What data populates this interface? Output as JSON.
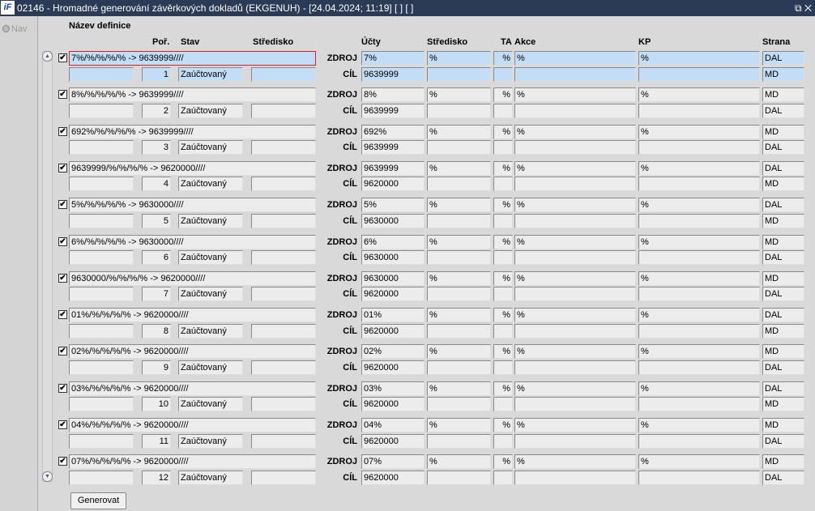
{
  "window": {
    "title": "02146 - Hromadné generování závěrkových dokladů (EKGENUH) - [24.04.2024; 11:19]  [ ]  [ ]",
    "logo": "iF",
    "controls": "⧉ ✕"
  },
  "nav": {
    "label": "Nav"
  },
  "headers": {
    "nazev": "Název definice",
    "por": "Poř.",
    "stav": "Stav",
    "stredisko": "Středisko",
    "ucty": "Účty",
    "stredisko2": "Středisko",
    "ta": "TA",
    "akce": "Akce",
    "kp": "KP",
    "strana": "Strana"
  },
  "labels": {
    "zdroj": "ZDROJ",
    "cil": "CÍL"
  },
  "rows": [
    {
      "checked": true,
      "name": "7%/%/%/%/% -> 9639999////",
      "por": "1",
      "stav": "Zaúčtovaný",
      "zdroj": {
        "ucty": "7%",
        "stredisko": "%",
        "ta": "%",
        "akce": "%",
        "kp": "%",
        "strana": "DAL"
      },
      "cil": {
        "ucty": "9639999",
        "strana": "MD"
      }
    },
    {
      "checked": true,
      "name": "8%/%/%/%/% -> 9639999////",
      "por": "2",
      "stav": "Zaúčtovaný",
      "zdroj": {
        "ucty": "8%",
        "stredisko": "%",
        "ta": "%",
        "akce": "%",
        "kp": "%",
        "strana": "MD"
      },
      "cil": {
        "ucty": "9639999",
        "strana": "DAL"
      }
    },
    {
      "checked": true,
      "name": "692%/%/%/%/% -> 9639999////",
      "por": "3",
      "stav": "Zaúčtovaný",
      "zdroj": {
        "ucty": "692%",
        "stredisko": "%",
        "ta": "%",
        "akce": "%",
        "kp": "%",
        "strana": "MD"
      },
      "cil": {
        "ucty": "9639999",
        "strana": "DAL"
      }
    },
    {
      "checked": true,
      "name": "9639999/%/%/%/% -> 9620000////",
      "por": "4",
      "stav": "Zaúčtovaný",
      "zdroj": {
        "ucty": "9639999",
        "stredisko": "%",
        "ta": "%",
        "akce": "%",
        "kp": "%",
        "strana": "DAL"
      },
      "cil": {
        "ucty": "9620000",
        "strana": "MD"
      }
    },
    {
      "checked": true,
      "name": "5%/%/%/%/% -> 9630000////",
      "por": "5",
      "stav": "Zaúčtovaný",
      "zdroj": {
        "ucty": "5%",
        "stredisko": "%",
        "ta": "%",
        "akce": "%",
        "kp": "%",
        "strana": "DAL"
      },
      "cil": {
        "ucty": "9630000",
        "strana": "MD"
      }
    },
    {
      "checked": true,
      "name": "6%/%/%/%/% -> 9630000////",
      "por": "6",
      "stav": "Zaúčtovaný",
      "zdroj": {
        "ucty": "6%",
        "stredisko": "%",
        "ta": "%",
        "akce": "%",
        "kp": "%",
        "strana": "MD"
      },
      "cil": {
        "ucty": "9630000",
        "strana": "DAL"
      }
    },
    {
      "checked": true,
      "name": "9630000/%/%/%/% -> 9620000////",
      "por": "7",
      "stav": "Zaúčtovaný",
      "zdroj": {
        "ucty": "9630000",
        "stredisko": "%",
        "ta": "%",
        "akce": "%",
        "kp": "%",
        "strana": "MD"
      },
      "cil": {
        "ucty": "9620000",
        "strana": "DAL"
      }
    },
    {
      "checked": true,
      "name": "01%/%/%/%/% -> 9620000////",
      "por": "8",
      "stav": "Zaúčtovaný",
      "zdroj": {
        "ucty": "01%",
        "stredisko": "%",
        "ta": "%",
        "akce": "%",
        "kp": "%",
        "strana": "DAL"
      },
      "cil": {
        "ucty": "9620000",
        "strana": "MD"
      }
    },
    {
      "checked": true,
      "name": "02%/%/%/%/% -> 9620000////",
      "por": "9",
      "stav": "Zaúčtovaný",
      "zdroj": {
        "ucty": "02%",
        "stredisko": "%",
        "ta": "%",
        "akce": "%",
        "kp": "%",
        "strana": "MD"
      },
      "cil": {
        "ucty": "9620000",
        "strana": "DAL"
      }
    },
    {
      "checked": true,
      "name": "03%/%/%/%/% -> 9620000////",
      "por": "10",
      "stav": "Zaúčtovaný",
      "zdroj": {
        "ucty": "03%",
        "stredisko": "%",
        "ta": "%",
        "akce": "%",
        "kp": "%",
        "strana": "DAL"
      },
      "cil": {
        "ucty": "9620000",
        "strana": "MD"
      }
    },
    {
      "checked": true,
      "name": "04%/%/%/%/% -> 9620000////",
      "por": "11",
      "stav": "Zaúčtovaný",
      "zdroj": {
        "ucty": "04%",
        "stredisko": "%",
        "ta": "%",
        "akce": "%",
        "kp": "%",
        "strana": "MD"
      },
      "cil": {
        "ucty": "9620000",
        "strana": "DAL"
      }
    },
    {
      "checked": true,
      "name": "07%/%/%/%/% -> 9620000////",
      "por": "12",
      "stav": "Zaúčtovaný",
      "zdroj": {
        "ucty": "07%",
        "stredisko": "%",
        "ta": "%",
        "akce": "%",
        "kp": "%",
        "strana": "MD"
      },
      "cil": {
        "ucty": "9620000",
        "strana": "DAL"
      }
    }
  ],
  "buttons": {
    "generovat": "Generovat"
  }
}
